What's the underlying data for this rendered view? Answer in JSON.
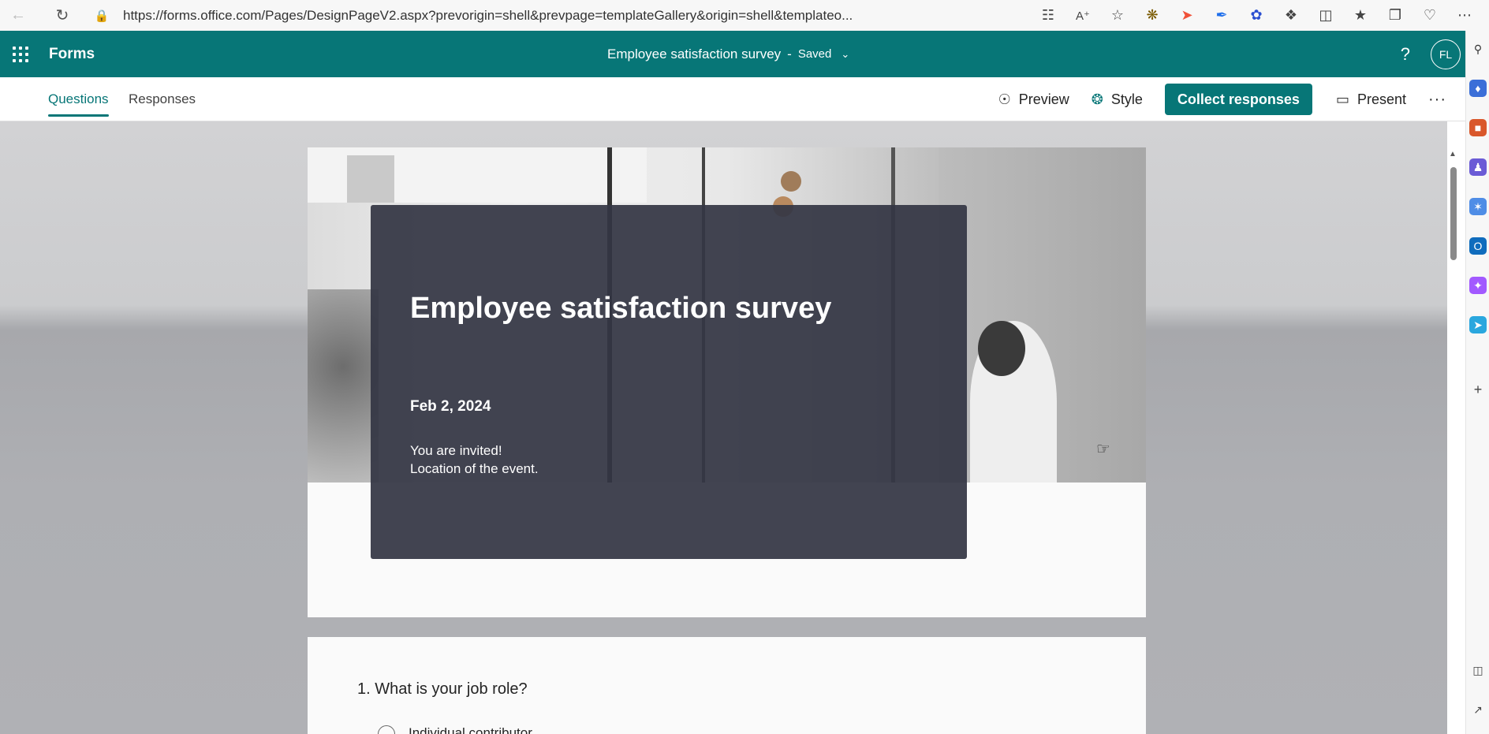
{
  "browser": {
    "url": "https://forms.office.com/Pages/DesignPageV2.aspx?prevorigin=shell&prevpage=templateGallery&origin=shell&templateo...",
    "icons": [
      "back-icon",
      "refresh-icon",
      "lock-icon",
      "app-available-icon",
      "read-aloud-icon",
      "favorite-star-icon",
      "extension-icon",
      "extension-icon",
      "extension-icon",
      "extension-icon",
      "extensions-puzzle-icon",
      "split-screen-icon",
      "favorites-icon",
      "collections-icon",
      "browser-essentials-icon",
      "more-icon"
    ]
  },
  "header": {
    "app_name": "Forms",
    "doc_title": "Employee satisfaction survey",
    "separator": "-",
    "status": "Saved",
    "help": "?",
    "avatar_initials": "FL",
    "bg_color": "#077677"
  },
  "command_bar": {
    "tabs": [
      {
        "label": "Questions",
        "active": true
      },
      {
        "label": "Responses",
        "active": false
      }
    ],
    "preview_label": "Preview",
    "style_label": "Style",
    "collect_label": "Collect responses",
    "present_label": "Present",
    "more_label": "···"
  },
  "hero": {
    "title": "Employee satisfaction survey",
    "date": "Feb 2, 2024",
    "description_line1": "You are invited!",
    "description_line2": "Location of the event."
  },
  "question": {
    "number_text": "1. What is your job role?",
    "first_option": "Individual contributor"
  }
}
